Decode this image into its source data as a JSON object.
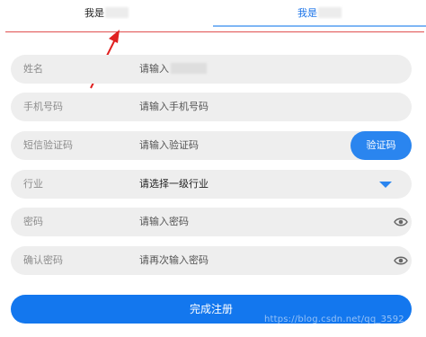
{
  "tabs": [
    {
      "label": "我是"
    },
    {
      "label": "我是"
    }
  ],
  "form": {
    "name": {
      "label": "姓名",
      "placeholder": "请输入"
    },
    "phone": {
      "label": "手机号码",
      "placeholder": "请输入手机号码"
    },
    "sms": {
      "label": "短信验证码",
      "placeholder": "请输入验证码",
      "button": "验证码"
    },
    "industry": {
      "label": "行业",
      "value": "请选择一级行业"
    },
    "password": {
      "label": "密码",
      "placeholder": "请输入密码"
    },
    "confirm": {
      "label": "确认密码",
      "placeholder": "请再次输入密码"
    }
  },
  "submit": {
    "label": "完成注册"
  },
  "watermark": "https://blog.csdn.net/qq_3592..."
}
